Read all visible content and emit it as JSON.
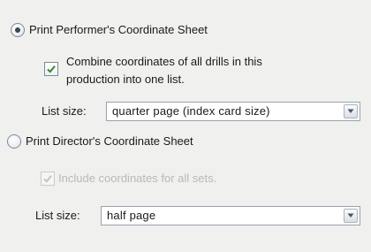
{
  "performer_option": {
    "label": "Print Performer's Coordinate Sheet",
    "selected": true,
    "combine_checkbox": {
      "label_line1": "Combine coordinates of all drills in this",
      "label_line2": "production into one list.",
      "checked": true
    },
    "list_size": {
      "label": "List size:",
      "value": "quarter page (index card size)"
    }
  },
  "director_option": {
    "label": "Print Director's Coordinate Sheet",
    "selected": false,
    "include_sets_checkbox": {
      "label": "Include coordinates for all sets.",
      "checked": true,
      "enabled": false
    },
    "list_size": {
      "label": "List size:",
      "value": "half page"
    }
  },
  "icons": {
    "checkmark": "checkmark-icon",
    "dropdown_arrow": "chevron-down-icon"
  }
}
